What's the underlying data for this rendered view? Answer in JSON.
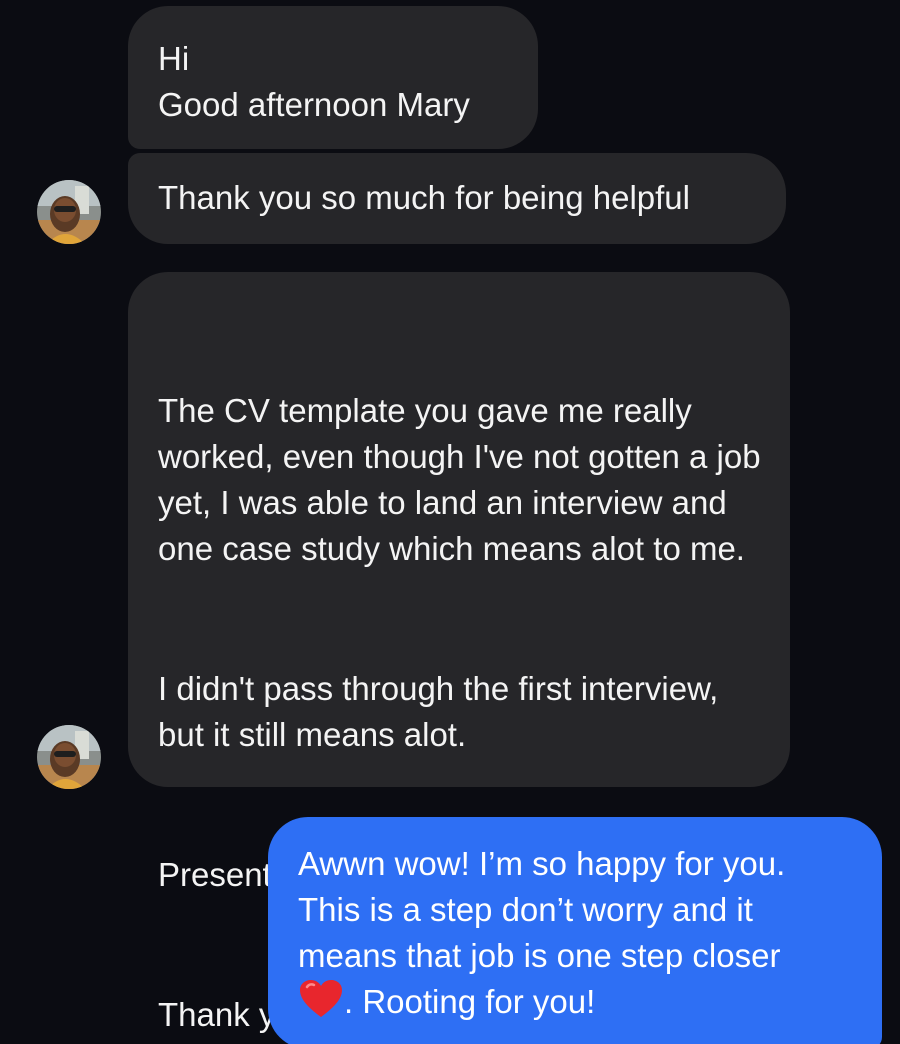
{
  "messages": [
    {
      "sender": "contact",
      "lines": [
        "Hi",
        "Good afternoon Mary"
      ]
    },
    {
      "sender": "contact",
      "text": "Thank you so much for being helpful"
    },
    {
      "sender": "contact",
      "paragraphs": [
        "The CV template you gave me really worked, even though I've not gotten a job yet, I was able to land an interview and one case study which means alot to me.",
        "I didn't pass through the first interview, but it still means alot.",
        "Presently I'm working on the case study",
        "Thank you so much"
      ]
    },
    {
      "sender": "me",
      "text_before_emoji": "Awwn wow! I’m so happy for you. This is a step don’t worry and it means that job is one step closer",
      "emoji": "red-heart-icon",
      "text_after_emoji": ". Rooting for you!"
    }
  ],
  "colors": {
    "background": "#0b0c12",
    "incoming_bubble": "#262629",
    "outgoing_bubble": "#2e6ff4",
    "heart": "#e8262d"
  }
}
